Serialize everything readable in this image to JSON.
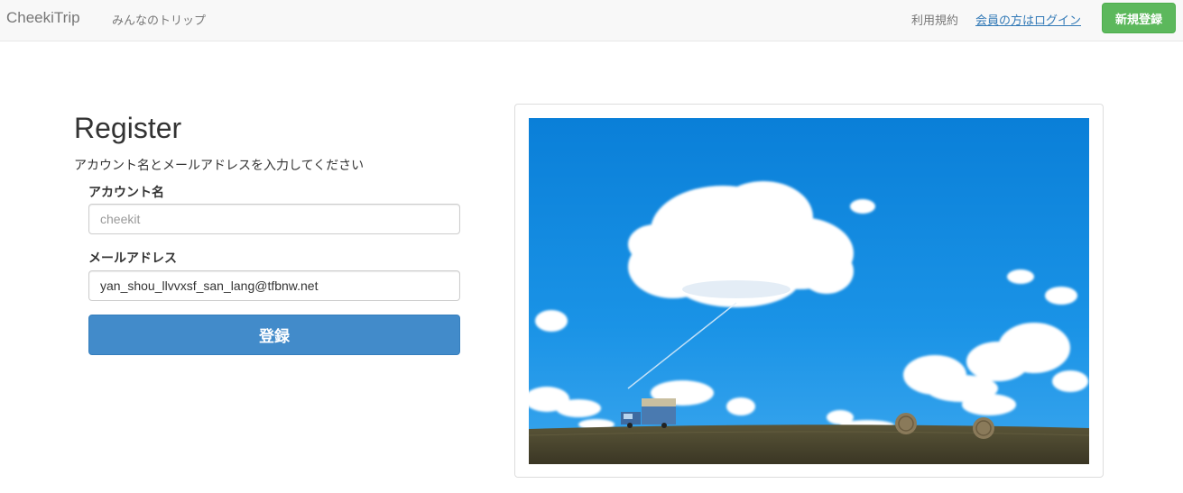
{
  "navbar": {
    "brand": "CheekiTrip",
    "trips_link": "みんなのトリップ",
    "terms_link": "利用規約",
    "login_link": "会員の方はログイン",
    "signup_button": "新規登録"
  },
  "form": {
    "title": "Register",
    "subtitle": "アカウント名とメールアドレスを入力してください",
    "account_label": "アカウント名",
    "account_placeholder": "cheekit",
    "account_value": "",
    "email_label": "メールアドレス",
    "email_value": "yan_shou_llvvxsf_san_lang@tfbnw.net",
    "submit_label": "登録"
  },
  "colors": {
    "sky": "#1a8fe0",
    "ground": "#4a4530",
    "signup": "#5cb85c",
    "submit": "#428bca"
  },
  "image": {
    "subject": "landscape-photo"
  }
}
